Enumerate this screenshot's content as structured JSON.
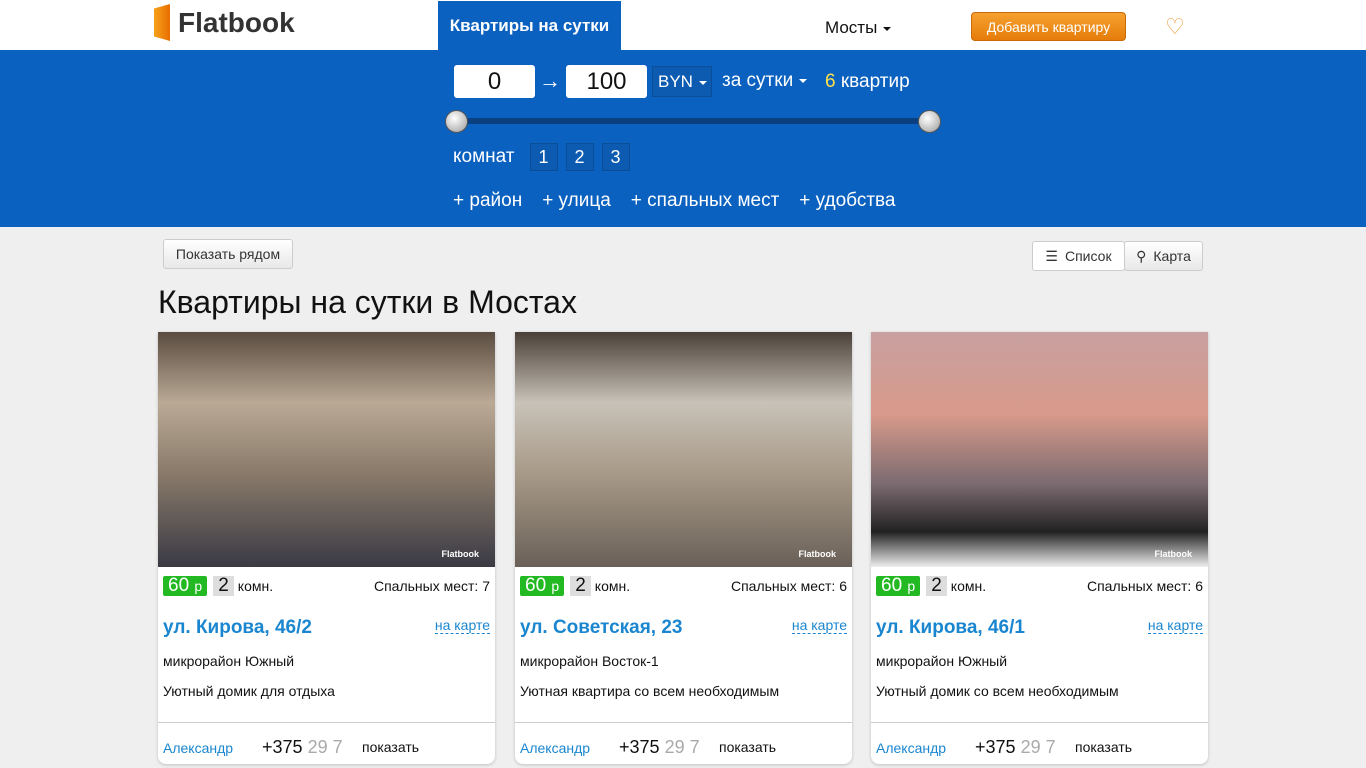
{
  "header": {
    "logo": "Flatbook",
    "nav_tab": "Квартиры на сутки",
    "city": "Мосты",
    "add_button": "Добавить квартиру",
    "favorites_icon": "heart-icon"
  },
  "filter": {
    "price_min": "0",
    "price_max": "100",
    "price_range_fraction": [
      0,
      1
    ],
    "currency": "BYN",
    "period": "за сутки",
    "count": "6",
    "count_label": "квартир",
    "rooms_label": "комнат",
    "rooms": [
      "1",
      "2",
      "3"
    ],
    "more": [
      "+ район",
      "+ улица",
      "+ спальных мест",
      "+ удобства"
    ]
  },
  "toolbar": {
    "nearby": "Показать рядом",
    "list": "Список",
    "map": "Карта"
  },
  "page_title": "Квартиры на сутки в Мостах",
  "listings": [
    {
      "price": "60",
      "currency": "р",
      "rooms": "2",
      "rooms_label": "комн.",
      "beds": "Спальных мест: 7",
      "address": "ул. Кирова, 46/2",
      "on_map": "на карте",
      "district": "микрорайон Южный",
      "description": "Уютный домик для отдыха",
      "owner": "Александр",
      "phone": "+375",
      "phone_hidden": "29 7",
      "show": "показать",
      "watermark": "Flatbook"
    },
    {
      "price": "60",
      "currency": "р",
      "rooms": "2",
      "rooms_label": "комн.",
      "beds": "Спальных мест: 6",
      "address": "ул. Советская, 23",
      "on_map": "на карте",
      "district": "микрорайон Восток-1",
      "description": "Уютная квартира со всем необходимым",
      "owner": "Александр",
      "phone": "+375",
      "phone_hidden": "29 7",
      "show": "показать",
      "watermark": "Flatbook"
    },
    {
      "price": "60",
      "currency": "р",
      "rooms": "2",
      "rooms_label": "комн.",
      "beds": "Спальных мест: 6",
      "address": "ул. Кирова, 46/1",
      "on_map": "на карте",
      "district": "микрорайон Южный",
      "description": "Уютный домик со всем необходимым",
      "owner": "Александр",
      "phone": "+375",
      "phone_hidden": "29 7",
      "show": "показать",
      "watermark": "Flatbook"
    }
  ]
}
